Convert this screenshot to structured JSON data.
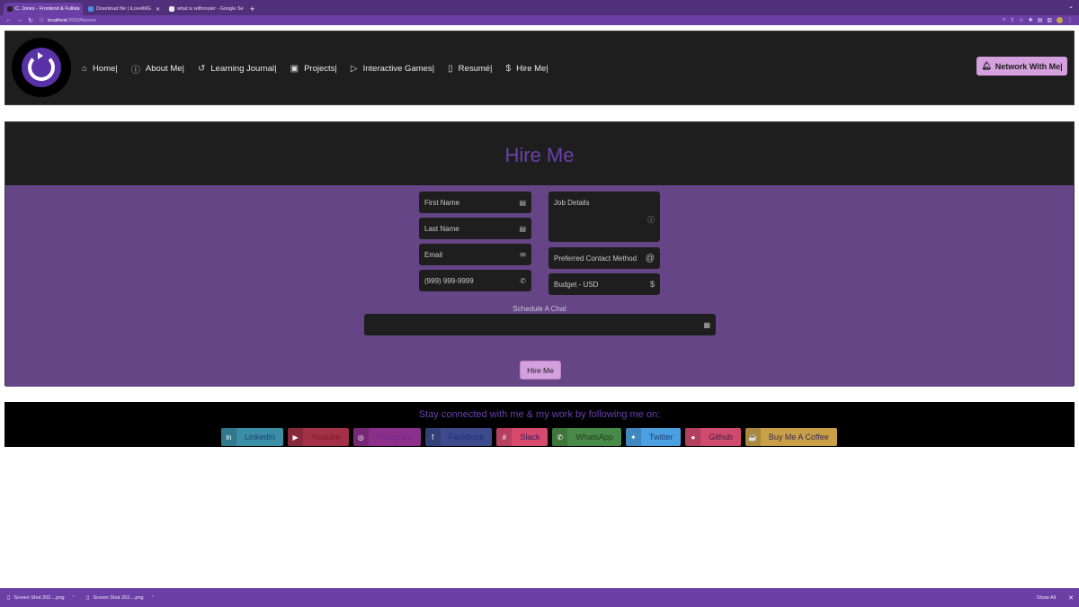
{
  "browser": {
    "tabs": [
      {
        "title": "C. Jones - Frontend & Fullsta",
        "active": true
      },
      {
        "title": "Download file | iLoveIMG",
        "active": false
      },
      {
        "title": "what is withrouter - Google Se",
        "active": false
      }
    ],
    "new_tab": "+",
    "url_host": "localhost",
    "url_path": ":3000/hireme"
  },
  "nav": {
    "items": [
      {
        "icon": "home-icon",
        "glyph": "⌂",
        "label": "Home|"
      },
      {
        "icon": "info-icon",
        "glyph": "ⓘ",
        "label": "About Me|"
      },
      {
        "icon": "history-icon",
        "glyph": "↺",
        "label": "Learning Journal|"
      },
      {
        "icon": "images-icon",
        "glyph": "▣",
        "label": "Projects|"
      },
      {
        "icon": "play-icon",
        "glyph": "▷",
        "label": "Interactive Games|"
      },
      {
        "icon": "file-icon",
        "glyph": "▯",
        "label": "Resumé|"
      },
      {
        "icon": "dollar-icon",
        "glyph": "$",
        "label": "Hire Me|"
      }
    ],
    "network_button": "Network With Me|"
  },
  "hire": {
    "title": "Hire Me",
    "fields": {
      "first_name": "First Name",
      "last_name": "Last Name",
      "email": "Email",
      "phone": "(999) 999-9999",
      "job_details": "Job Details",
      "contact_method": "Preferred Contact Method",
      "budget": "Budget - USD"
    },
    "schedule_label": "Schedule A Chat",
    "submit": "Hire Me"
  },
  "footer": {
    "title": "Stay connected with me & my work by following me on:",
    "socials": [
      {
        "label": "LinkedIn",
        "icon": "linkedin-icon",
        "glyph": "in",
        "bg": "#3a8ea6",
        "fg": "#1d3f73"
      },
      {
        "label": "Youtube",
        "icon": "youtube-icon",
        "glyph": "▶",
        "bg": "#a33046",
        "fg": "#7a1a26"
      },
      {
        "label": "Instagram",
        "icon": "instagram-icon",
        "glyph": "◎",
        "bg": "#8b2f8a",
        "fg": "#7a2a8f"
      },
      {
        "label": "Facebook",
        "icon": "facebook-icon",
        "glyph": "f",
        "bg": "#3d4a8c",
        "fg": "#1f2f7a"
      },
      {
        "label": "Slack",
        "icon": "slack-icon",
        "glyph": "#",
        "bg": "#d64a6e",
        "fg": "#3b1d5a"
      },
      {
        "label": "WhatsApp",
        "icon": "whatsapp-icon",
        "glyph": "✆",
        "bg": "#4a8a48",
        "fg": "#1e3d1e"
      },
      {
        "label": "Twitter",
        "icon": "twitter-icon",
        "glyph": "✦",
        "bg": "#4aa0e0",
        "fg": "#1d3f73"
      },
      {
        "label": "Github",
        "icon": "github-icon",
        "glyph": "●",
        "bg": "#d04a6e",
        "fg": "#3b1d3a"
      },
      {
        "label": "Buy Me A Coffee",
        "icon": "coffee-icon",
        "glyph": "☕",
        "bg": "#c9a048",
        "fg": "#3b2a5a"
      }
    ]
  },
  "downloads": {
    "items": [
      "Screen Shot 202....png",
      "Screen Shot 202....png"
    ],
    "show_all": "Show All"
  }
}
